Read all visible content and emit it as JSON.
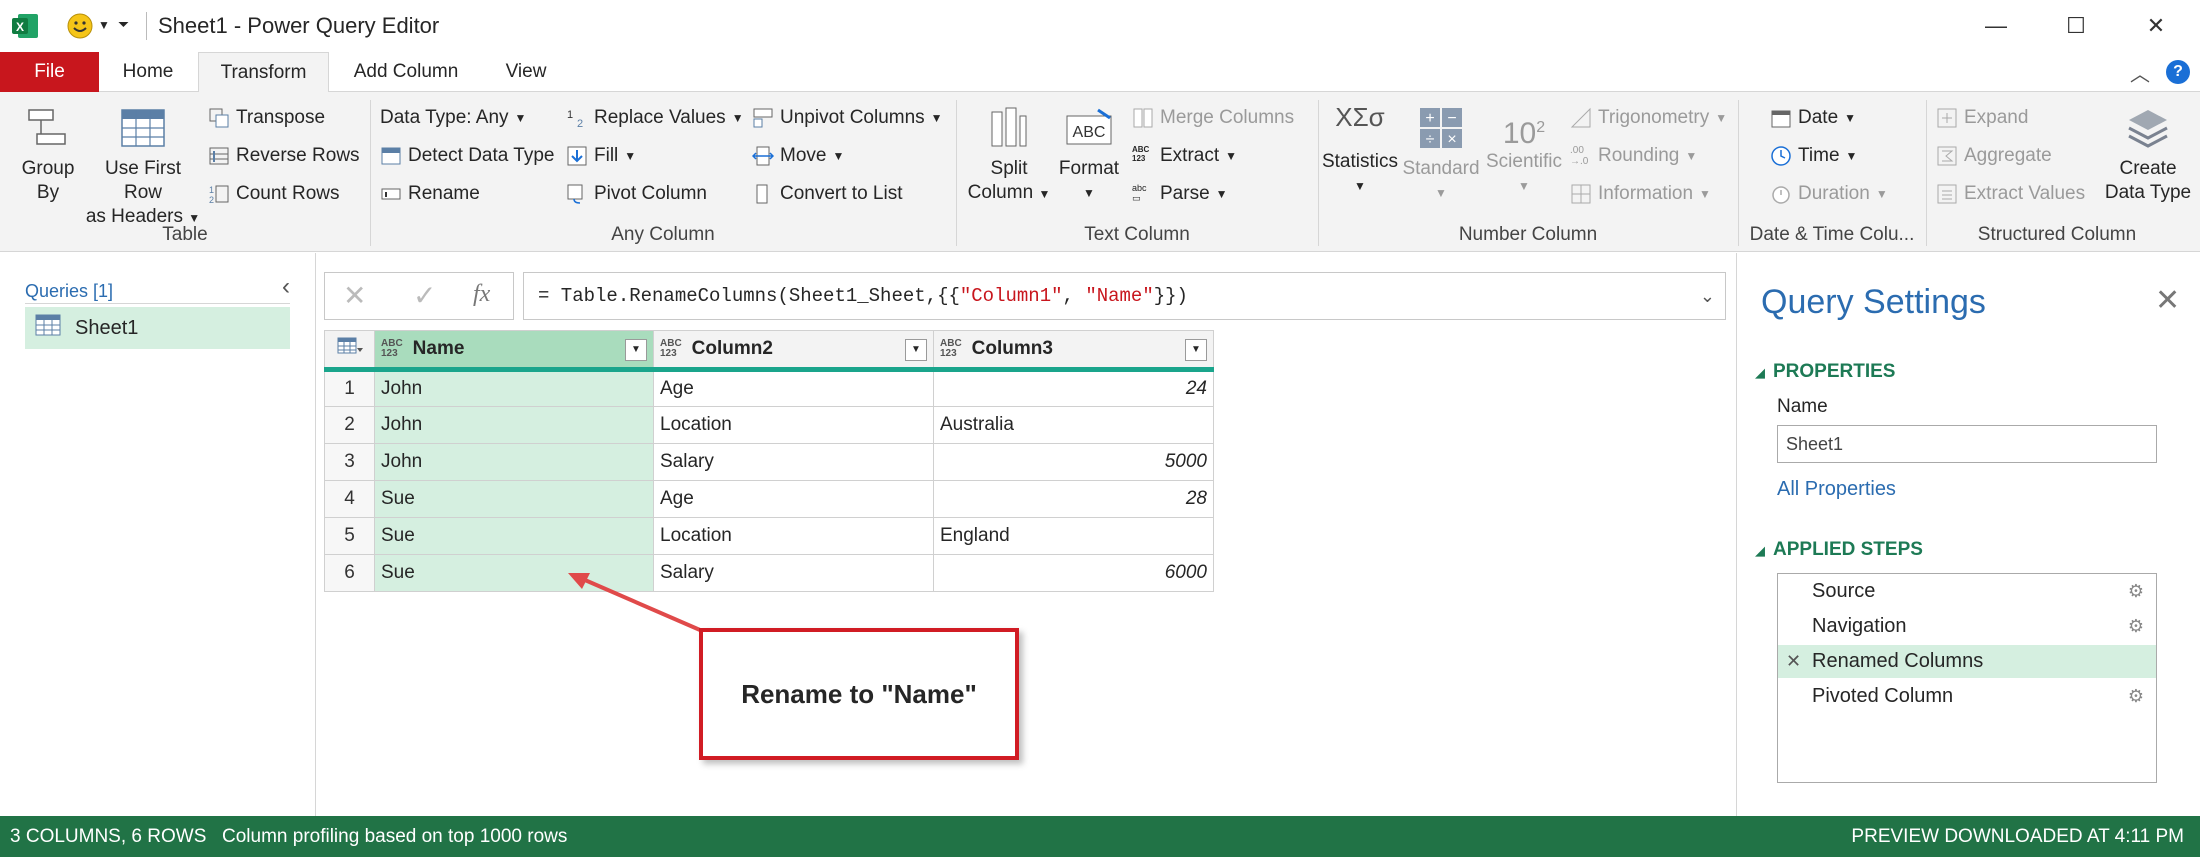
{
  "window": {
    "title": "Sheet1 - Power Query Editor",
    "minimize": "—",
    "maximize": "☐",
    "close": "✕"
  },
  "tabs": [
    "File",
    "Home",
    "Transform",
    "Add Column",
    "View"
  ],
  "ribbon": {
    "table": {
      "group_by_1": "Group",
      "group_by_2": "By",
      "first_row_1": "Use First Row",
      "first_row_2": "as Headers",
      "transpose": "Transpose",
      "reverse_rows": "Reverse Rows",
      "count_rows": "Count Rows",
      "label": "Table"
    },
    "any_column": {
      "data_type": "Data Type: Any",
      "detect_data_type": "Detect Data Type",
      "rename": "Rename",
      "replace_values": "Replace Values",
      "fill": "Fill",
      "pivot_column": "Pivot Column",
      "unpivot_columns": "Unpivot Columns",
      "move": "Move",
      "convert_to_list": "Convert to List",
      "label": "Any Column"
    },
    "text_column": {
      "split_1": "Split",
      "split_2": "Column",
      "format": "Format",
      "merge_columns": "Merge Columns",
      "extract": "Extract",
      "parse": "Parse",
      "label": "Text Column"
    },
    "number_column": {
      "statistics": "Statistics",
      "standard": "Standard",
      "scientific": "Scientific",
      "trigonometry": "Trigonometry",
      "rounding": "Rounding",
      "information": "Information",
      "label": "Number Column"
    },
    "date_time": {
      "date": "Date",
      "time": "Time",
      "duration": "Duration",
      "label": "Date & Time Colu..."
    },
    "structured": {
      "expand": "Expand",
      "aggregate": "Aggregate",
      "extract_values": "Extract Values",
      "create_1": "Create",
      "create_2": "Data Type",
      "label": "Structured Column"
    }
  },
  "queries": {
    "header": "Queries [1]",
    "items": [
      "Sheet1"
    ]
  },
  "formula": {
    "prefix": "= Table.RenameColumns(Sheet1_Sheet,{{",
    "arg1": "\"Column1\"",
    "sep": ", ",
    "arg2": "\"Name\"",
    "suffix": "}})"
  },
  "grid": {
    "type_label_top": "ABC",
    "type_label_bottom": "123",
    "columns": [
      "Name",
      "Column2",
      "Column3"
    ],
    "rows": [
      {
        "n": "1",
        "c1": "John",
        "c2": "Age",
        "c3": "24"
      },
      {
        "n": "2",
        "c1": "John",
        "c2": "Location",
        "c3": "Australia"
      },
      {
        "n": "3",
        "c1": "John",
        "c2": "Salary",
        "c3": "5000"
      },
      {
        "n": "4",
        "c1": "Sue",
        "c2": "Age",
        "c3": "28"
      },
      {
        "n": "5",
        "c1": "Sue",
        "c2": "Location",
        "c3": "England"
      },
      {
        "n": "6",
        "c1": "Sue",
        "c2": "Salary",
        "c3": "6000"
      }
    ]
  },
  "callout": "Rename to \"Name\"",
  "settings": {
    "title": "Query Settings",
    "properties": "PROPERTIES",
    "name_label": "Name",
    "name_value": "Sheet1",
    "all_properties": "All Properties",
    "applied_steps": "APPLIED STEPS",
    "steps": [
      "Source",
      "Navigation",
      "Renamed Columns",
      "Pivoted Column"
    ]
  },
  "status": {
    "left": "3 COLUMNS, 6 ROWS",
    "profiling": "Column profiling based on top 1000 rows",
    "right": "PREVIEW DOWNLOADED AT 4:11 PM"
  },
  "colors": {
    "file_tab": "#c8161d",
    "status_bar": "#217346",
    "selection": "#d5efe0",
    "accent_blue": "#2b6cb0",
    "callout_border": "#d11c24"
  }
}
